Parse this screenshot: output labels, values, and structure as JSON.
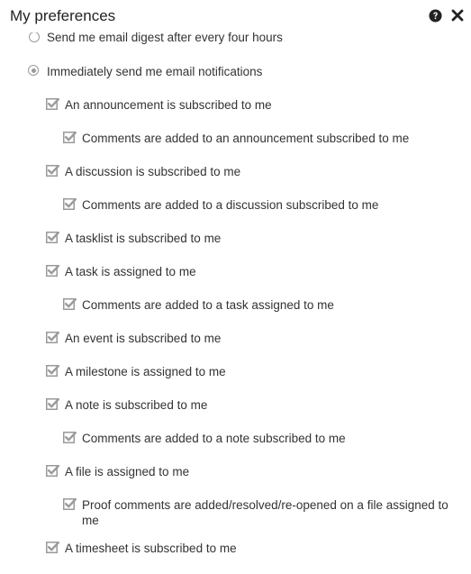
{
  "dialog": {
    "title": "My preferences",
    "help_icon": "question-circle-icon",
    "close_icon": "close-icon"
  },
  "options": {
    "digest_label": "Send me email digest after every four hours",
    "digest_selected": false,
    "immediate_label": "Immediately send me email notifications",
    "immediate_selected": true
  },
  "notifications": [
    {
      "label": "An announcement is subscribed to me",
      "checked": true
    },
    {
      "label": "Comments are added to an announcement subscribed to me",
      "checked": true
    },
    {
      "label": "A discussion is subscribed to me",
      "checked": true
    },
    {
      "label": "Comments are added to a discussion subscribed to me",
      "checked": true
    },
    {
      "label": "A tasklist is subscribed to me",
      "checked": true
    },
    {
      "label": "A task is assigned to me",
      "checked": true
    },
    {
      "label": "Comments are added to a task assigned to me",
      "checked": true
    },
    {
      "label": "An event is subscribed to me",
      "checked": true
    },
    {
      "label": "A milestone is assigned to me",
      "checked": true
    },
    {
      "label": "A note is subscribed to me",
      "checked": true
    },
    {
      "label": "Comments are added to a note subscribed to me",
      "checked": true
    },
    {
      "label": "A file is assigned to me",
      "checked": true
    },
    {
      "label": "Proof comments are added/resolved/re-opened on a file assigned to me",
      "checked": true
    },
    {
      "label": "A timesheet is subscribed to me",
      "checked": true
    }
  ],
  "colors": {
    "check_gray": "#9a9a9a",
    "text": "#333333"
  }
}
